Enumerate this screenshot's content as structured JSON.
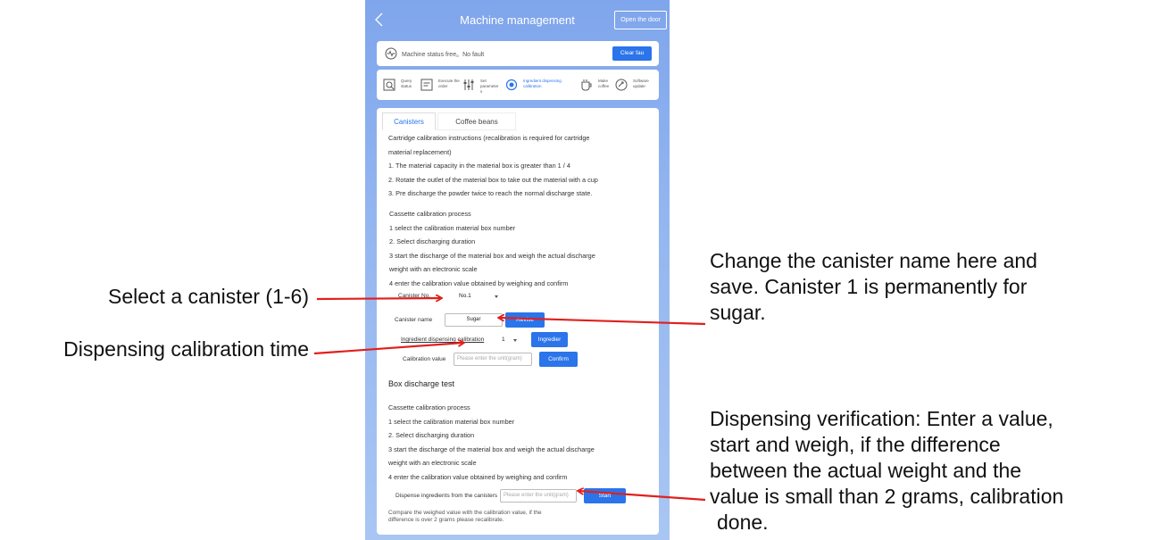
{
  "annotations": {
    "select_canister": "Select a canister (1-6)",
    "dispense_time": "Dispensing calibration time",
    "canister_name_lines": [
      "Change the canister name here and",
      "save. Canister 1 is permanently for",
      "sugar."
    ],
    "verification_lines": [
      "Dispensing verification: Enter a value,",
      "start and weigh, if the difference",
      "between the actual weight and the",
      "value is small than 2 grams, calibration",
      "done."
    ]
  },
  "app": {
    "title": "Machine management",
    "open_door_label": "Open the door",
    "status_text": "Machine status  free。No fault",
    "clear_fault_label": "Clear fau",
    "functions": [
      {
        "label": "Query status",
        "icon": "query-status-icon"
      },
      {
        "label": "Execute the order",
        "icon": "order-icon"
      },
      {
        "label": "Set parameter s",
        "icon": "parameter-icon"
      },
      {
        "label": "Ingredient dispensing calibration",
        "icon": "calibration-icon"
      },
      {
        "label": "Make coffee",
        "icon": "coffee-icon"
      },
      {
        "label": "Software update",
        "icon": "update-icon"
      }
    ]
  },
  "tabs": [
    {
      "label": "Canisters",
      "active": true
    },
    {
      "label": "Coffee beans",
      "active": false
    }
  ],
  "instructions": [
    "Cartridge calibration instructions (recalibration is required for cartridge",
    "material replacement)",
    " 1. The material capacity in the material box is greater than 1 / 4",
    " 2. Rotate the outlet of the material box to take out the material with a cup",
    " 3. Pre discharge the powder twice to reach the normal discharge state."
  ],
  "process": [
    "Cassette calibration process",
    "1 select the calibration material box number",
    "2. Select discharging duration",
    "3 start the discharge of the material box and weigh the actual discharge",
    "weight with an electronic scale",
    "4 enter the calibration value obtained by weighing and confirm"
  ],
  "form": {
    "canister_no_label": "Canister No.",
    "canister_no_value": "No.1",
    "canister_name_label": "Canister name",
    "canister_name_value": "Sugar",
    "revise_label": "Revise",
    "dispense_label": "Ingredient dispensing calibration",
    "dispense_value": "1",
    "ingredient_btn_label": "Ingredier",
    "calib_value_label": "Calibration value",
    "calib_value_placeholder": "Please enter the unit(gram)",
    "confirm_label": "Confirm"
  },
  "test": {
    "title": "Box discharge test",
    "dispense_label": "Dispense ingredients from the canisters",
    "dispense_placeholder": "Please enter the unit(gram)",
    "start_label": "Start",
    "note_lines": [
      "Compare the weighed value with the calibration value, if the",
      "difference is over 2 grams please recalibrate."
    ]
  },
  "colors": {
    "accent": "#2b74ea",
    "arrow": "#e0201e",
    "background_top": "#7fa5ec"
  }
}
